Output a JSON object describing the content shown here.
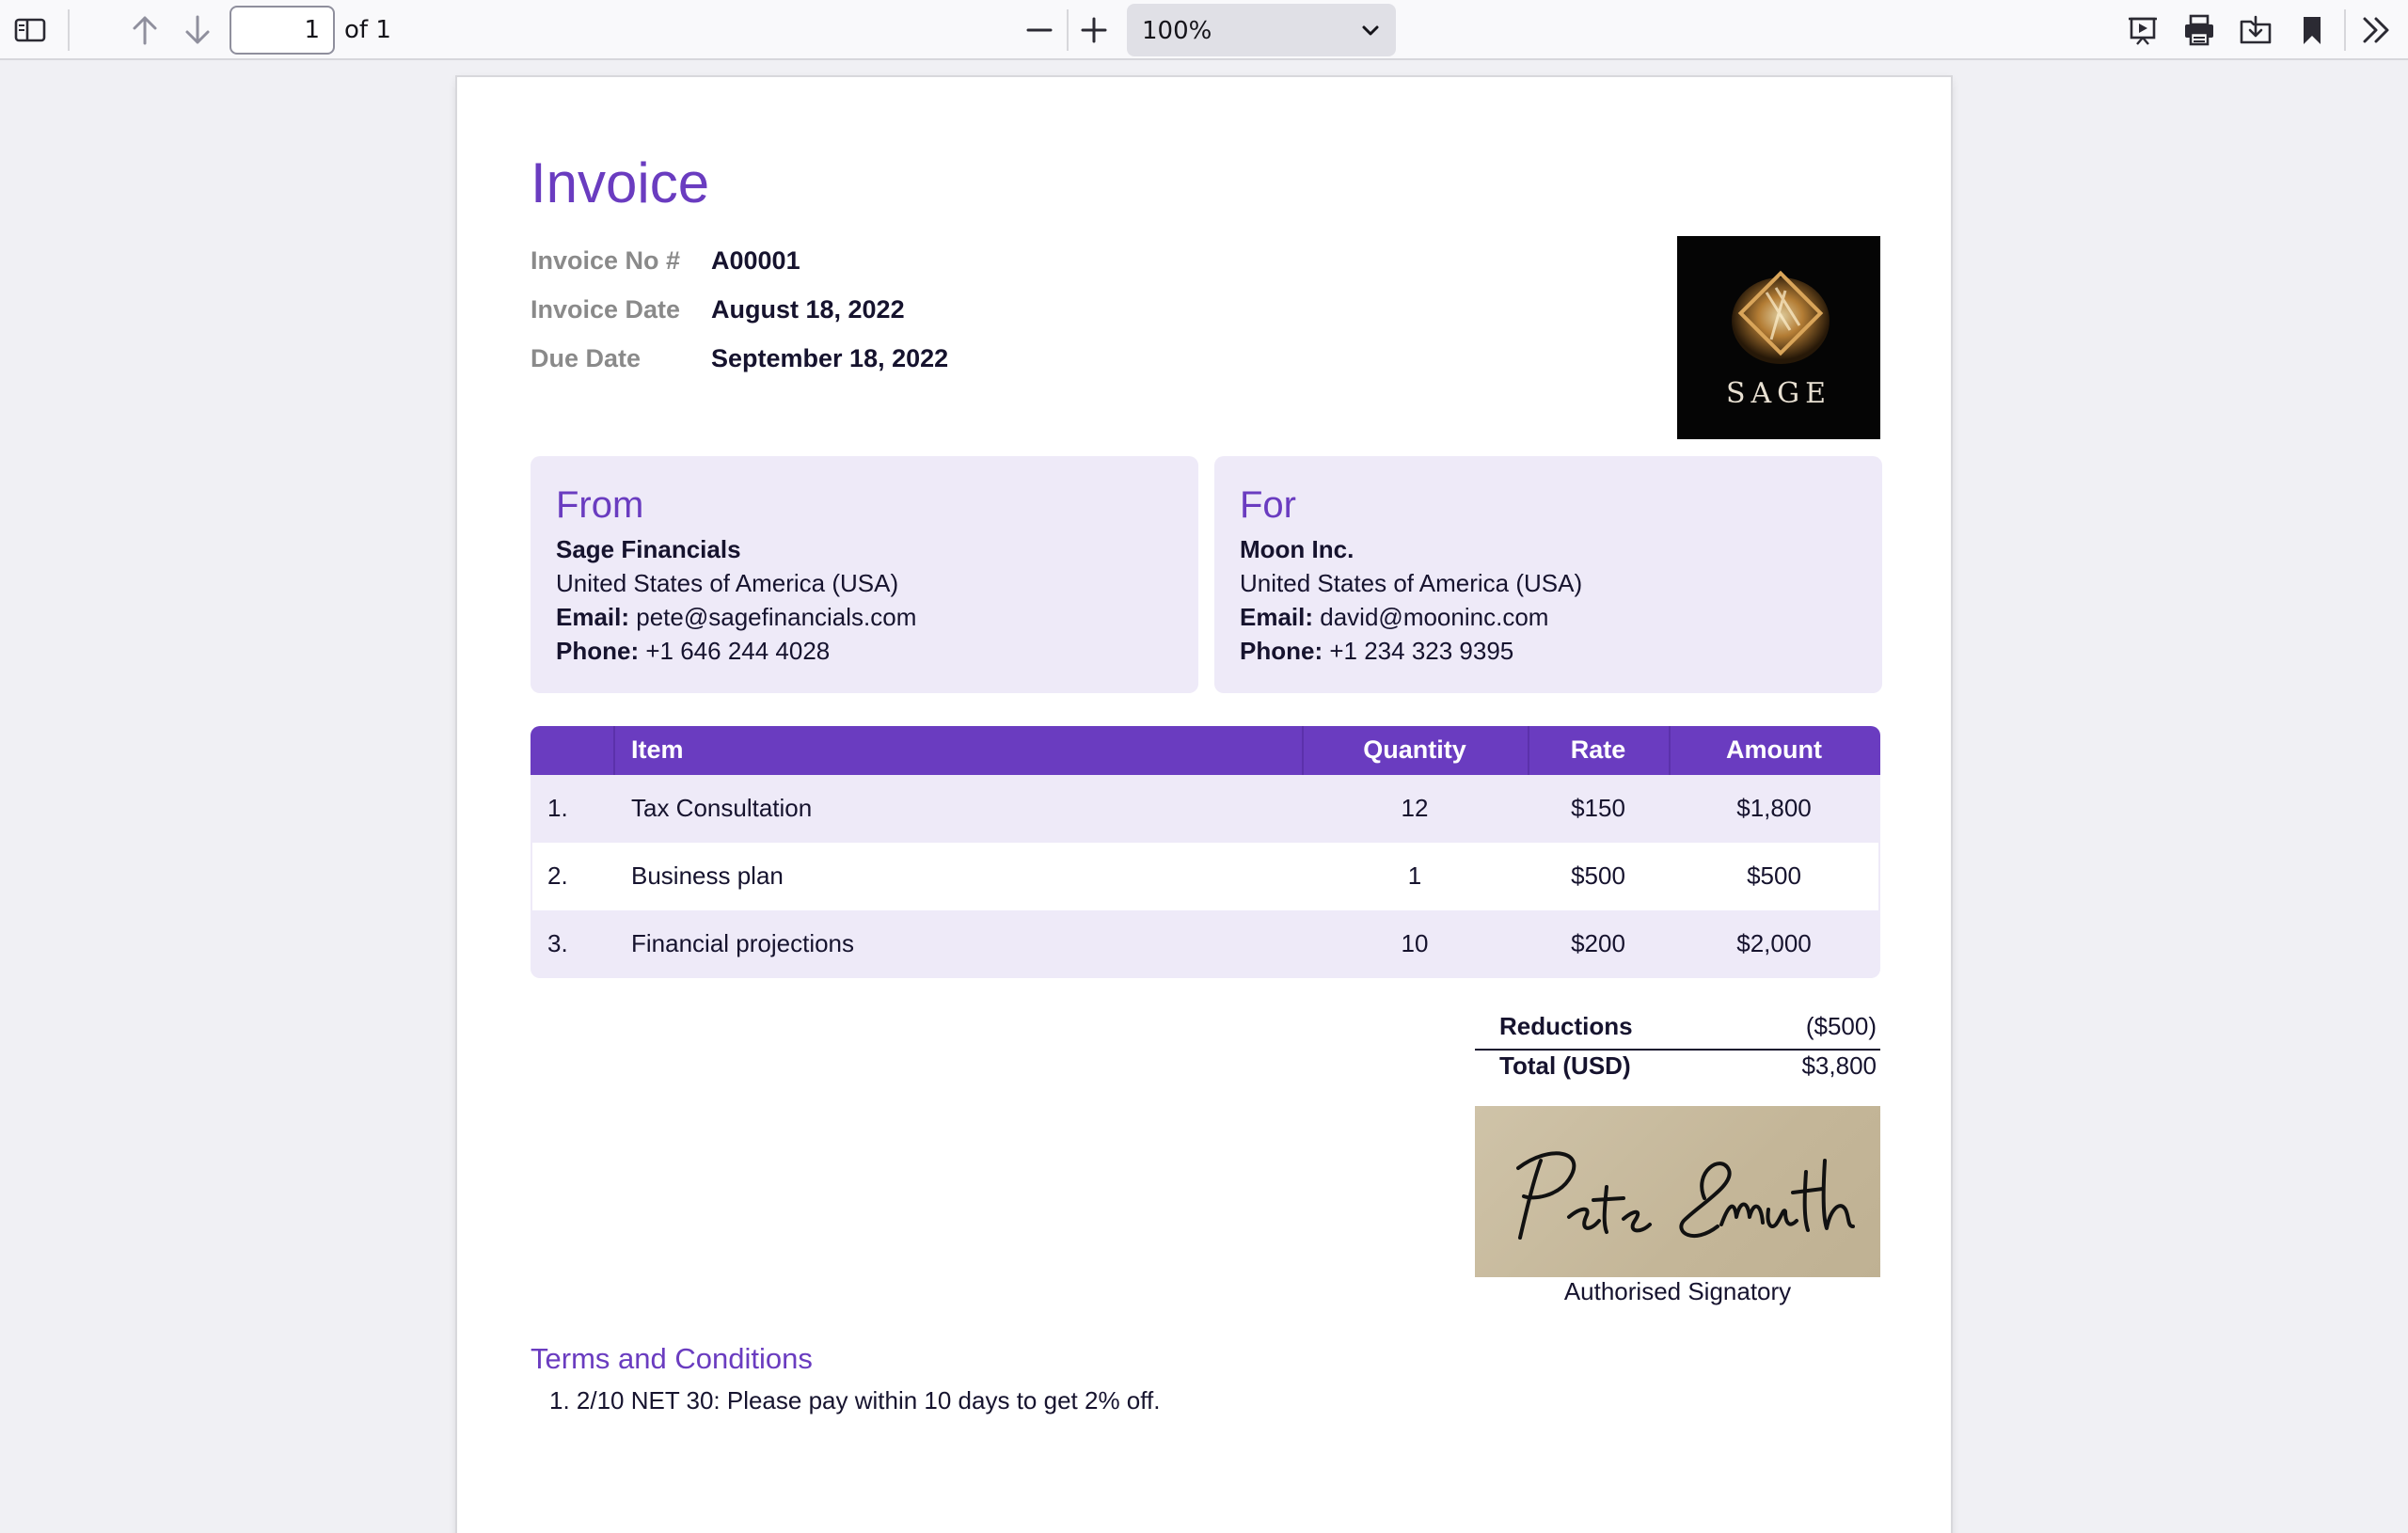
{
  "toolbar": {
    "page_number": "1",
    "page_of": "of 1",
    "zoom": "100%",
    "icons": [
      "sidebar-toggle-icon",
      "arrow-up-icon",
      "arrow-down-icon",
      "minus-icon",
      "plus-icon",
      "presentation-icon",
      "print-icon",
      "save-icon",
      "bookmark-icon",
      "double-chevron-right-icon"
    ]
  },
  "invoice": {
    "title": "Invoice",
    "meta": [
      {
        "label": "Invoice No #",
        "value": "A00001"
      },
      {
        "label": "Invoice Date",
        "value": "August 18, 2022"
      },
      {
        "label": "Due Date",
        "value": "September 18, 2022"
      }
    ],
    "logo_text": "SAGE",
    "from": {
      "heading": "From",
      "name": "Sage Financials",
      "country": "United States of America (USA)",
      "email_label": "Email:",
      "email": "pete@sagefinancials.com",
      "phone_label": "Phone:",
      "phone": "+1 646 244 4028"
    },
    "for": {
      "heading": "For",
      "name": "Moon Inc.",
      "country": "United States of America (USA)",
      "email_label": "Email:",
      "email": "david@mooninc.com",
      "phone_label": "Phone:",
      "phone": "+1 234 323 9395"
    },
    "table": {
      "headers": {
        "item": "Item",
        "quantity": "Quantity",
        "rate": "Rate",
        "amount": "Amount"
      },
      "rows": [
        {
          "num": "1.",
          "item": "Tax Consultation",
          "quantity": "12",
          "rate": "$150",
          "amount": "$1,800"
        },
        {
          "num": "2.",
          "item": "Business plan",
          "quantity": "1",
          "rate": "$500",
          "amount": "$500"
        },
        {
          "num": "3.",
          "item": "Financial projections",
          "quantity": "10",
          "rate": "$200",
          "amount": "$2,000"
        }
      ]
    },
    "totals": {
      "reductions_label": "Reductions",
      "reductions_value": "($500)",
      "total_label": "Total (USD)",
      "total_value": "$3,800"
    },
    "signature_name": "Pete Smith",
    "signature_caption": "Authorised Signatory",
    "terms_heading": "Terms and Conditions",
    "terms": [
      "1. 2/10 NET 30: Please pay within 10 days to get 2% off."
    ]
  },
  "colors": {
    "accent": "#6a3cc0",
    "panel": "#eeeaf8",
    "text": "#16132e"
  }
}
